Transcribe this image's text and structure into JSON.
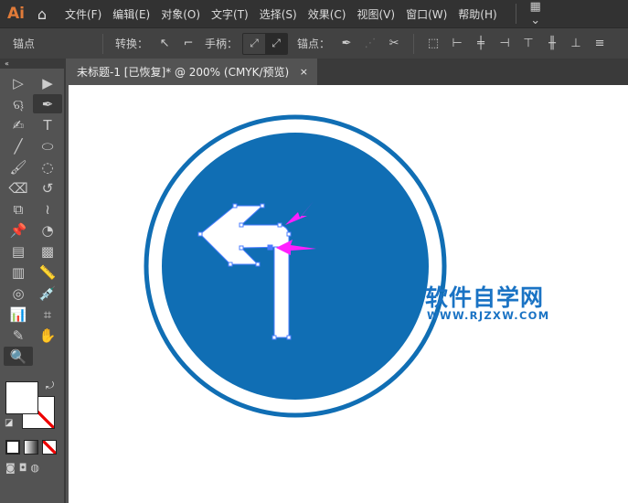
{
  "app": {
    "logo": "Ai"
  },
  "menu": [
    "文件(F)",
    "编辑(E)",
    "对象(O)",
    "文字(T)",
    "选择(S)",
    "效果(C)",
    "视图(V)",
    "窗口(W)",
    "帮助(H)"
  ],
  "control": {
    "mode": "锚点",
    "convert_label": "转换：",
    "handles_label": "手柄：",
    "anchor_label": "锚点："
  },
  "tab": {
    "title": "未标题-1 [已恢复]* @ 200% (CMYK/预览)",
    "close": "×"
  },
  "watermark": {
    "title": "软件自学网",
    "url": "WWW.RJZXW.COM"
  },
  "colors": {
    "sign_blue": "#106eb4",
    "selection": "#4a7cff",
    "arrow_magenta": "#ff20ff"
  }
}
